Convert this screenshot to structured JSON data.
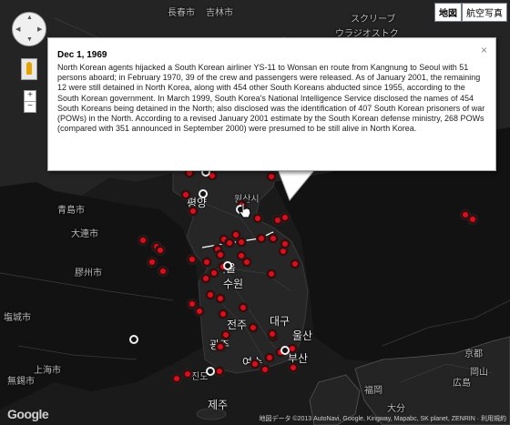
{
  "map_type": {
    "map": "地図",
    "satellite": "航空写真"
  },
  "controls": {
    "zoom_in": "+",
    "zoom_out": "−"
  },
  "info": {
    "date": "Dec 1, 1969",
    "text": "North Korean agents hijacked a South Korean airliner YS-11 to Wonsan en route from Kangnung to Seoul with 51 persons aboard; in February 1970, 39 of the crew and passengers were released. As of January 2001, the remaining 12 were still detained in North Korea, along with 454 other South Koreans abducted since 1955, according to the South Korean government. In March 1999, South Korea's National Intelligence Service disclosed the names of 454 South Koreans being detained in the North; also disclosed was the identification of 407 South Korean prisoners of war (POWs) in the North. According to a revised January 2001 estimate by the South Korean defense ministry, 268 POWs (compared with 351 announced in September 2000) were presumed to be still alive in North Korea.",
    "close": "×"
  },
  "labels": [
    {
      "id": "changchun",
      "text": "長春市"
    },
    {
      "id": "jilin",
      "text": "吉林市"
    },
    {
      "id": "sapporo",
      "text": "スクリーブ"
    },
    {
      "id": "vladivostok",
      "text": "ウラジオストク"
    },
    {
      "id": "dalian",
      "text": "大連市"
    },
    {
      "id": "pyongyang",
      "text": "평양"
    },
    {
      "id": "wonsan",
      "text": "원산시"
    },
    {
      "id": "qingdao",
      "text": "青島市"
    },
    {
      "id": "seoul",
      "text": "서울"
    },
    {
      "id": "suwon",
      "text": "수원"
    },
    {
      "id": "jeonju",
      "text": "전주"
    },
    {
      "id": "daegu",
      "text": "대구"
    },
    {
      "id": "ulsan",
      "text": "울산"
    },
    {
      "id": "busan",
      "text": "부산"
    },
    {
      "id": "gwangju",
      "text": "광주"
    },
    {
      "id": "yeosu",
      "text": "여수"
    },
    {
      "id": "jindo",
      "text": "진도"
    },
    {
      "id": "jeju",
      "text": "제주"
    },
    {
      "id": "shanghai",
      "text": "上海市"
    },
    {
      "id": "wuxi",
      "text": "無錫市"
    },
    {
      "id": "jiaozhou",
      "text": "膠州市"
    },
    {
      "id": "yancheng",
      "text": "塩城市"
    },
    {
      "id": "hiroshima",
      "text": "広島"
    },
    {
      "id": "okayama",
      "text": "岡山"
    },
    {
      "id": "kyoto",
      "text": "京都"
    },
    {
      "id": "oita",
      "text": "大分"
    },
    {
      "id": "fukuoka",
      "text": "福岡"
    }
  ],
  "attribution": {
    "google": "Google",
    "text": "地図データ ©2013 AutoNavi, Google, Kingway, Mapabc, SK planet, ZENRIN · 利用規約"
  }
}
